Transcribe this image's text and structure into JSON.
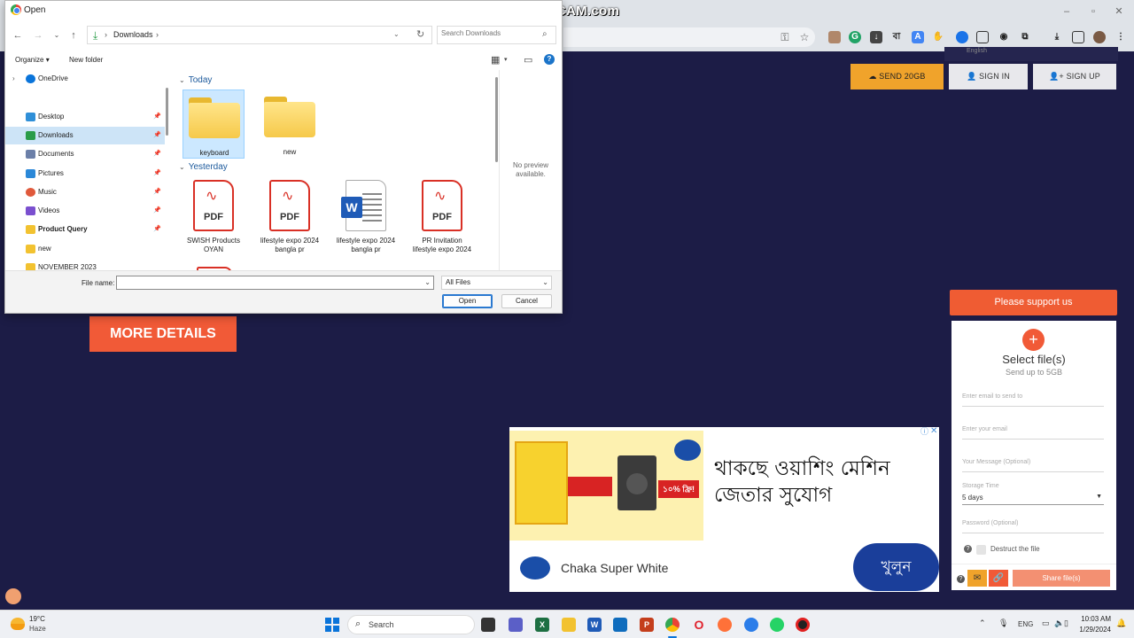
{
  "watermark": "www.BANDICAM.com",
  "site": {
    "send_label": "SEND 20GB",
    "signin_label": "SIGN IN",
    "signup_label": "SIGN UP",
    "more_details": "MORE DETAILS",
    "support_label": "Please support us",
    "select_files": "Select file(s)",
    "send_up_to": "Send up to 5GB",
    "email_to_placeholder": "Enter email to send to",
    "your_email_placeholder": "Enter your email",
    "message_placeholder": "Your Message (Optional)",
    "storage_label": "Storage Time",
    "storage_value": "5 days",
    "password_placeholder": "Password (Optional)",
    "destruct_label": "Destruct the file",
    "share_label": "Share file(s)",
    "lang_label": "English"
  },
  "ad": {
    "headline_line1": "থাকছে ওয়াশিং মেশিন",
    "headline_line2": "জেতার সুযোগ",
    "brand": "Chaka Super White",
    "cta": "খুলুন",
    "tag": "১০% ফ্রি!"
  },
  "dialog": {
    "title": "Open",
    "address": "Downloads",
    "search_placeholder": "Search Downloads",
    "organize": "Organize",
    "new_folder": "New folder",
    "nav_items": [
      {
        "label": "OneDrive",
        "color": "#0a74da",
        "expand": ">"
      },
      {
        "label": "Desktop",
        "color": "#2f8fd8",
        "pin": true
      },
      {
        "label": "Downloads",
        "color": "#2a9c48",
        "pin": true
      },
      {
        "label": "Documents",
        "color": "#6b7fa8",
        "pin": true
      },
      {
        "label": "Pictures",
        "color": "#2b88d8",
        "pin": true
      },
      {
        "label": "Music",
        "color": "#e0593b",
        "pin": true
      },
      {
        "label": "Videos",
        "color": "#7a4fcf",
        "pin": true
      },
      {
        "label": "Product Query",
        "color": "#f2c230",
        "pin": true
      },
      {
        "label": "new",
        "color": "#f2c230"
      },
      {
        "label": "NOVEMBER 2023",
        "color": "#f2c230"
      }
    ],
    "groups": {
      "today": "Today",
      "yesterday": "Yesterday"
    },
    "today_files": [
      {
        "name": "keyboard",
        "type": "folder"
      },
      {
        "name": "new",
        "type": "folder"
      }
    ],
    "yesterday_files": [
      {
        "name": "SWISH Products OYAN",
        "type": "pdf"
      },
      {
        "name": "lifestyle expo 2024 bangla pr",
        "type": "pdf"
      },
      {
        "name": "lifestyle expo 2024 bangla pr",
        "type": "word"
      },
      {
        "name": "PR Invitation lifestyle expo 2024",
        "type": "pdf"
      }
    ],
    "pdf_label": "PDF",
    "word_badge": "W",
    "no_preview": "No preview available.",
    "file_name_label": "File name:",
    "file_name_value": "",
    "file_type": "All Files",
    "open_label": "Open",
    "cancel_label": "Cancel"
  },
  "taskbar": {
    "temp": "19°C",
    "weather": "Haze",
    "search": "Search",
    "lang": "ENG",
    "time": "10:03 AM",
    "date": "1/29/2024"
  }
}
